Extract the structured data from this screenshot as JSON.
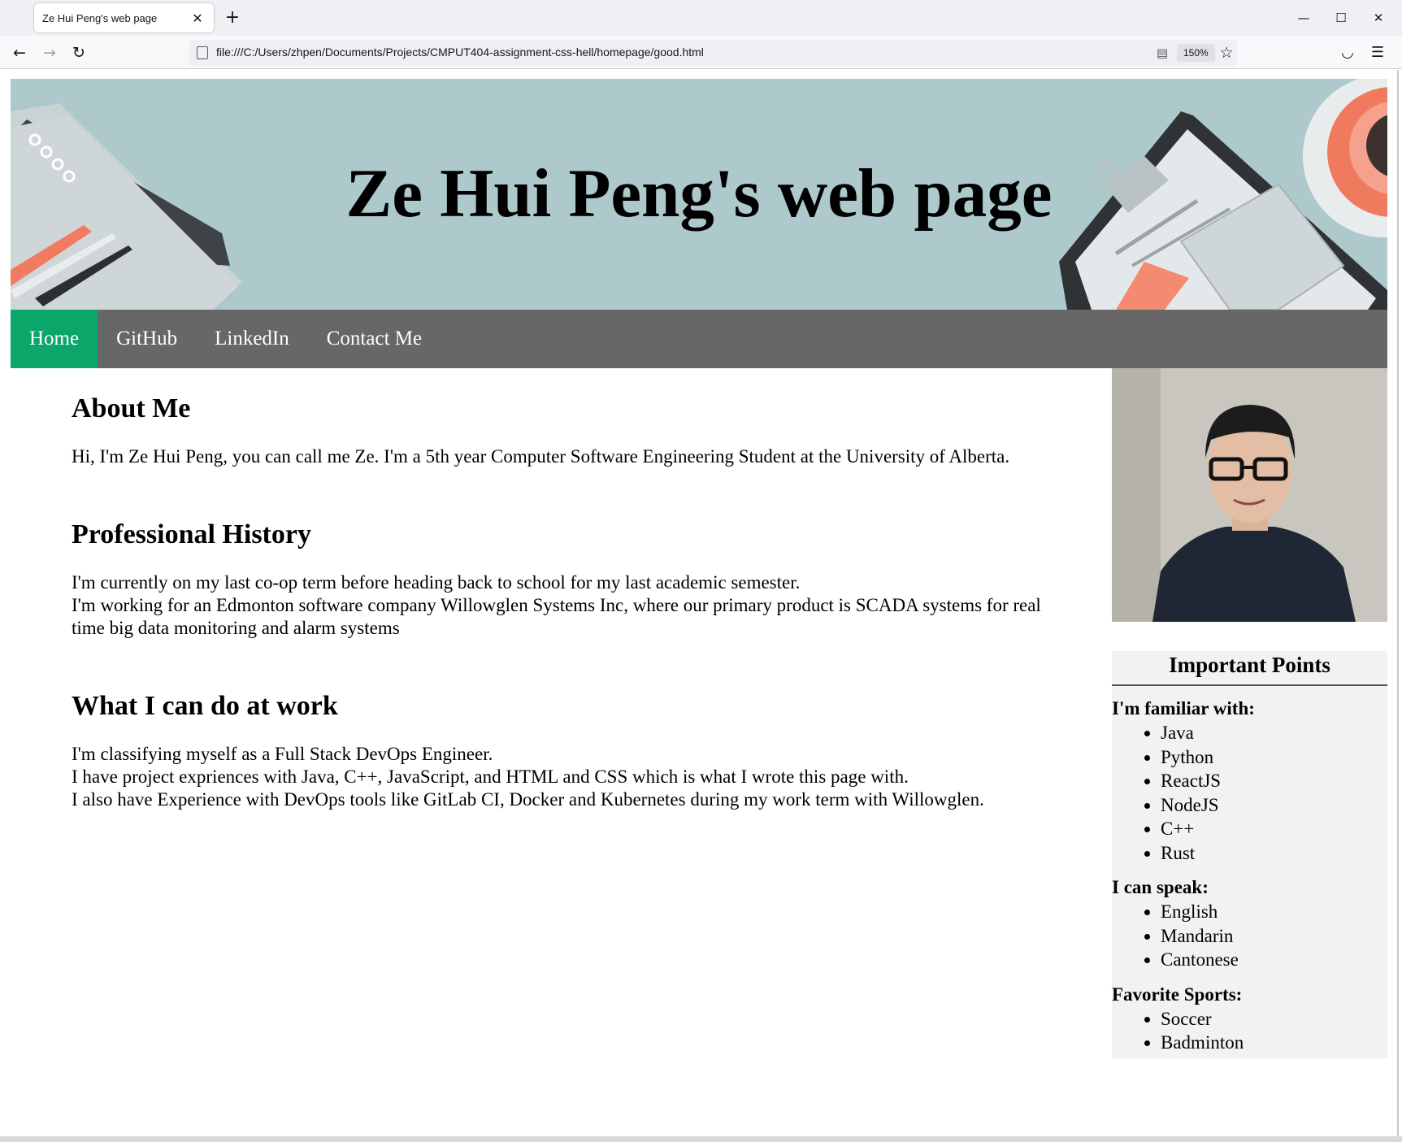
{
  "browser": {
    "tab_title": "Ze Hui Peng's web page",
    "tab_close": "✕",
    "new_tab": "+",
    "url": "file:///C:/Users/zhpen/Documents/Projects/CMPUT404-assignment-css-hell/homepage/good.html",
    "zoom": "150%",
    "icons": {
      "back": "←",
      "forward": "→",
      "reload": "↻",
      "reader": "▤",
      "star": "☆",
      "pocket": "◡",
      "menu": "☰",
      "minimize": "—",
      "maximize": "☐",
      "close": "✕"
    }
  },
  "header": {
    "title": "Ze Hui Peng's web page",
    "background_color": "#aec9cb"
  },
  "nav": {
    "items": [
      "Home",
      "GitHub",
      "LinkedIn",
      "Contact Me"
    ],
    "active_color": "#0aa66a",
    "bar_color": "#676767"
  },
  "main": {
    "about": {
      "heading": "About Me",
      "text": "Hi, I'm Ze Hui Peng, you can call me Ze. I'm a 5th year Computer Software Engineering Student at the University of Alberta."
    },
    "history": {
      "heading": "Professional History",
      "line1": "I'm currently on my last co-op term before heading back to school for my last academic semester.",
      "line2": "I'm working for an Edmonton software company Willowglen Systems Inc, where our primary product is SCADA systems for real time big data monitoring and alarm systems"
    },
    "work": {
      "heading": "What I can do at work",
      "line1": "I'm classifying myself as a Full Stack DevOps Engineer.",
      "line2": "I have project expriences with Java, C++, JavaScript, and HTML and CSS which is what I wrote this page with.",
      "line3": "I also have Experience with DevOps tools like GitLab CI, Docker and Kubernetes during my work term with Willowglen."
    }
  },
  "sidebar": {
    "heading": "Important Points",
    "familiar_heading": "I'm familiar with:",
    "familiar": [
      "Java",
      "Python",
      "ReactJS",
      "NodeJS",
      "C++",
      "Rust"
    ],
    "speak_heading": "I can speak:",
    "speak": [
      "English",
      "Mandarin",
      "Cantonese"
    ],
    "sports_heading": "Favorite Sports:",
    "sports": [
      "Soccer",
      "Badminton"
    ]
  }
}
